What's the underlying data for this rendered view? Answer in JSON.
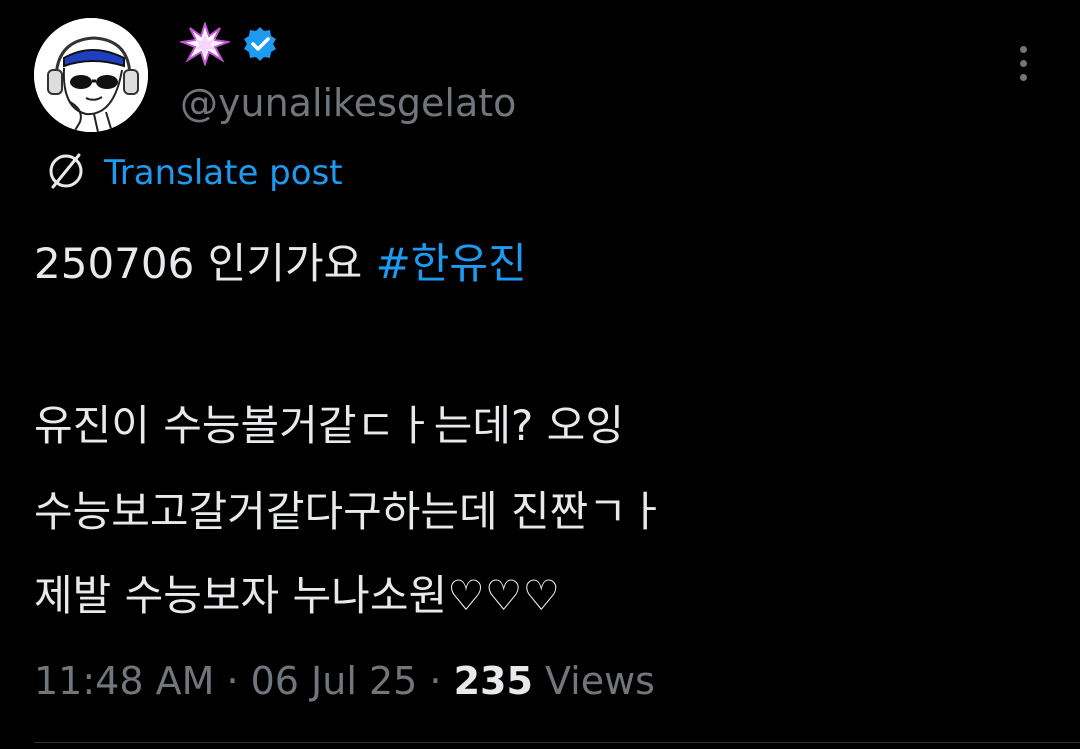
{
  "author": {
    "display_name_icon": "collision-emoji-icon",
    "verified_icon": "verified-badge-icon",
    "handle": "@yunalikesgelato"
  },
  "translate": {
    "label": "Translate post"
  },
  "post": {
    "line1_text": "250706 인기가요 ",
    "line1_hashtag": "#한유진",
    "line2": "유진이 수능볼거같ㄷㅏ는데? 오잉",
    "line3": "수능보고갈거같다구하는데 진짠ㄱㅏ",
    "line4": "제발 수능보자 누나소원♡♡♡"
  },
  "meta": {
    "time": "11:48 AM",
    "separator": " · ",
    "date": "06 Jul 25",
    "views_count": "235",
    "views_label": " Views"
  },
  "colors": {
    "background": "#000000",
    "text": "#e7e9ea",
    "secondary": "#71767b",
    "accent": "#1d9bf0"
  }
}
